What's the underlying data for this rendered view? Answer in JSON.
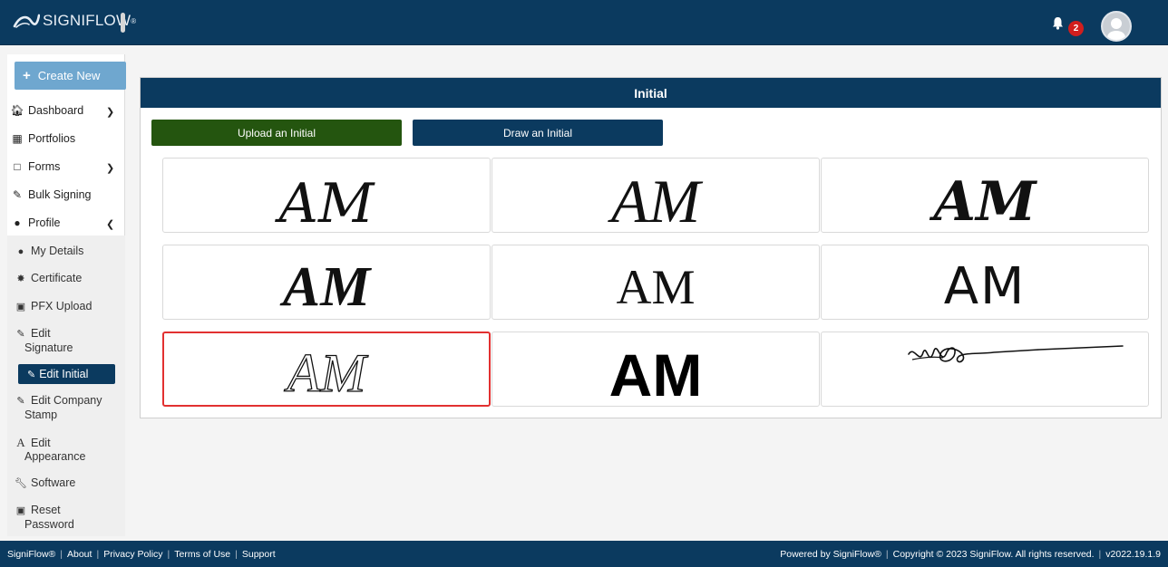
{
  "app": {
    "brand": "SIGNIFLOW",
    "notification_count": "2",
    "colors": {
      "header": "#0b3a5f",
      "upload_button": "#24550f",
      "create_button": "#6fa7cf",
      "selected_border": "#e23030"
    }
  },
  "sidebar": {
    "create_new": "Create New",
    "items": [
      {
        "label": "Dashboard",
        "icon": "home-icon",
        "expand": "chevron-down"
      },
      {
        "label": "Portfolios",
        "icon": "portfolio-icon"
      },
      {
        "label": "Forms",
        "icon": "forms-icon",
        "expand": "chevron-down"
      },
      {
        "label": "Bulk Signing",
        "icon": "bulk-signing-icon"
      },
      {
        "label": "Profile",
        "icon": "user-icon",
        "expand": "chevron-up"
      }
    ],
    "profile_items": [
      {
        "label": "My Details",
        "icon": "user-icon"
      },
      {
        "label": "Certificate",
        "icon": "certificate-icon"
      },
      {
        "label": "PFX Upload",
        "icon": "pfx-file-icon"
      },
      {
        "label": "Edit",
        "label2": "Signature",
        "icon": "edit-icon"
      },
      {
        "label": "Edit Initial",
        "icon": "edit-icon",
        "active": true
      },
      {
        "label": "Edit Company",
        "label2": "Stamp",
        "icon": "edit-icon"
      },
      {
        "label": "Edit",
        "label2": "Appearance",
        "icon": "font-icon"
      },
      {
        "label": "Software",
        "icon": "wrench-icon"
      },
      {
        "label": "Reset",
        "label2": "Password",
        "icon": "lock-icon"
      }
    ]
  },
  "main": {
    "title": "Initial",
    "upload_button": "Upload an Initial",
    "draw_button": "Draw an Initial",
    "initials": [
      {
        "text": "AM",
        "style": "upright-brush"
      },
      {
        "text": "AM",
        "style": "script-serif"
      },
      {
        "text": "AM",
        "style": "bold-blackletter-italic"
      },
      {
        "text": "AM",
        "style": "bold-brush-italic"
      },
      {
        "text": "AM",
        "style": "decorative-serif"
      },
      {
        "text": "AM",
        "style": "handwritten-thin"
      },
      {
        "text": "AM",
        "style": "calligraphic-italic",
        "selected": true
      },
      {
        "text": "AM",
        "style": "bold-sans"
      },
      {
        "text": "",
        "style": "drawn-scribble"
      }
    ]
  },
  "footer": {
    "left_links": [
      "SigniFlow®",
      "About",
      "Privacy Policy",
      "Terms of Use",
      "Support"
    ],
    "powered_by": "Powered by SigniFlow®",
    "copyright": "Copyright © 2023 SigniFlow. All rights reserved.",
    "version": "v2022.19.1.9"
  }
}
